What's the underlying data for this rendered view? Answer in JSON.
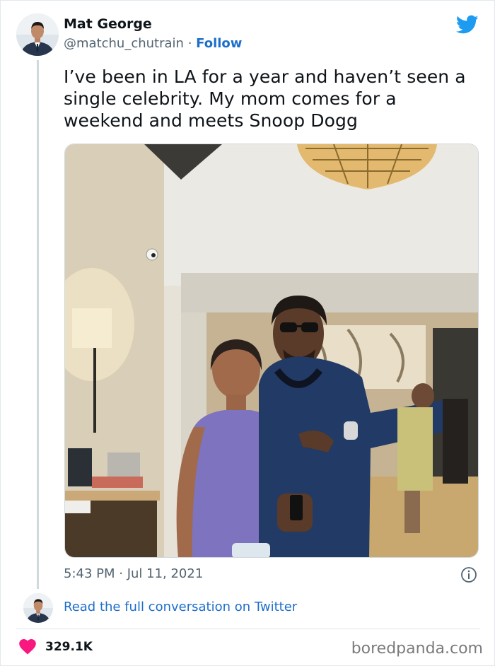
{
  "author": {
    "name": "Mat George",
    "handle": "@matchu_chutrain",
    "separator": "·",
    "follow_label": "Follow"
  },
  "tweet": {
    "text": "I’ve been in LA for a year and haven’t seen a single celebrity. My mom comes for a weekend and meets Snoop Dogg",
    "timestamp": "5:43 PM · Jul 11, 2021"
  },
  "conversation_link": "Read the full conversation on Twitter",
  "likes": {
    "count": "329.1K"
  },
  "watermark": "boredpanda.com",
  "colors": {
    "link_blue": "#1d6ec9",
    "twitter_blue": "#1d9bf0",
    "heart_pink": "#f91880",
    "muted_text": "#536471"
  },
  "icons": {
    "brand": "twitter-bird-icon",
    "info": "info-icon",
    "like": "heart-icon"
  }
}
